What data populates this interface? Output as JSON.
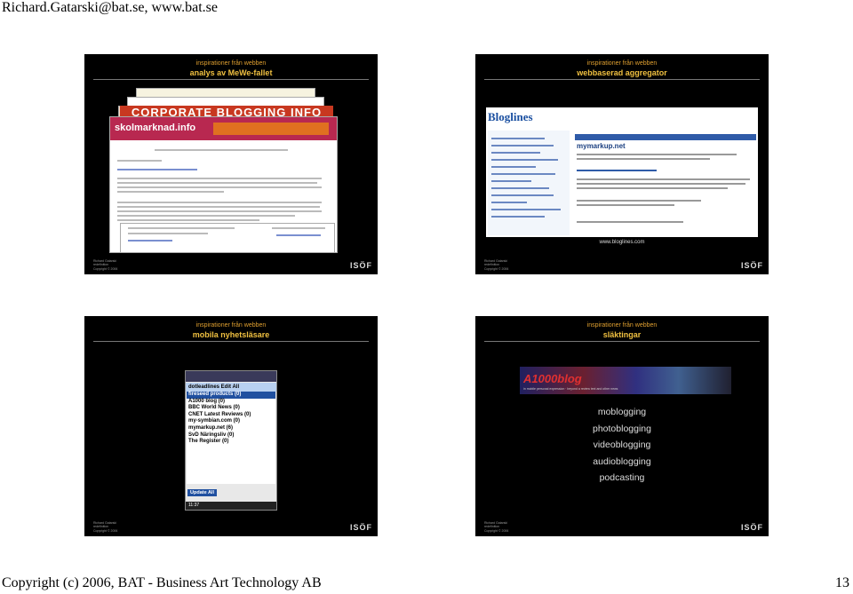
{
  "page": {
    "header": "Richard.Gatarski@bat.se, www.bat.se",
    "footer_left": "Copyright (c) 2006, BAT - Business Art Technology AB",
    "page_number": "13"
  },
  "slide_common": {
    "kicker": "inspirationer från webben",
    "author_name": "Richard Gatarski",
    "author_org": "redefinition",
    "author_copyright": "Copyright © 2006",
    "logo_mark": "ISÖF"
  },
  "slides": [
    {
      "title": "analys av MeWe-fallet",
      "screens": {
        "corporate_banner": "CORPORATE BLOGGING INFO",
        "site_logo": "skolmarknad.info"
      }
    },
    {
      "title": "webbaserad aggregator",
      "screens": {
        "app_logo": "Bloglines",
        "feed_title": "mymarkup.net"
      },
      "caption": "www.bloglines.com"
    },
    {
      "title": "mobila nyhetsläsare",
      "phone": {
        "menu": "dotleadlines   Edit          All",
        "items": [
          "fireseed products (0)",
          "A1000 blog (0)",
          "BBC World News (0)",
          "CNET Latest Reviews (0)",
          "my-symbian.com (0)",
          "mymarkup.net (6)",
          "SvD Näringsliv (0)",
          "The Register (0)"
        ],
        "selected_index": 0,
        "update_button": "Update All",
        "status_time": "11:37"
      }
    },
    {
      "title": "släktingar",
      "banner": {
        "logo": "A1000blog",
        "subtitle": "in mobile personal expression  ·  beyond a review text and other news"
      },
      "terms": [
        "moblogging",
        "photoblogging",
        "videoblogging",
        "audioblogging",
        "podcasting"
      ]
    }
  ]
}
